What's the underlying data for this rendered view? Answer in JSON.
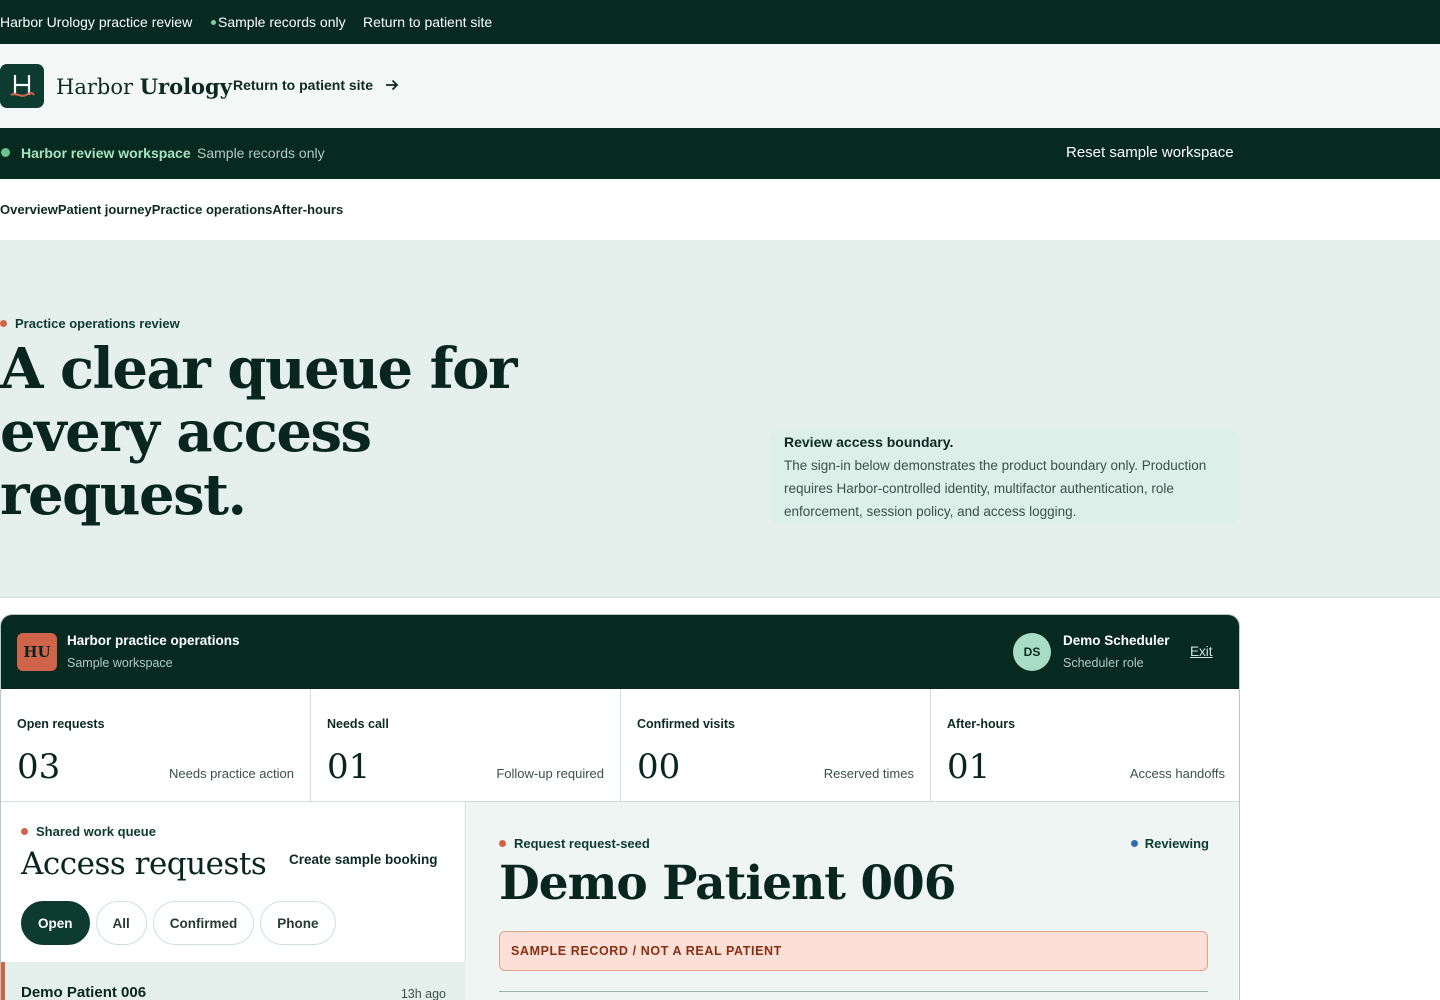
{
  "topbar": {
    "title": "Harbor Urology practice review",
    "sample_note": "Sample records only",
    "return_link": "Return to patient site"
  },
  "brand": {
    "name_light": "Harbor",
    "name_bold": "Urology",
    "return_link": "Return to patient site"
  },
  "workspace_bar": {
    "name": "Harbor review workspace",
    "sample_note": "Sample records only",
    "reset_label": "Reset sample workspace"
  },
  "nav": {
    "items": [
      "Overview",
      "Patient journey",
      "Practice operations",
      "After-hours"
    ]
  },
  "hero": {
    "eyebrow": "Practice operations review",
    "headline": "A clear queue for every access request.",
    "notice_title": "Review access boundary.",
    "notice_body": "The sign-in below demonstrates the product boundary only. Production requires Harbor-controlled identity, multifactor authentication, role enforcement, session policy, and access logging."
  },
  "dashboard": {
    "org_initials": "HU",
    "org_name": "Harbor practice operations",
    "org_sub": "Sample workspace",
    "user_initials": "DS",
    "user_name": "Demo Scheduler",
    "user_role": "Scheduler role",
    "exit_label": "Exit",
    "stats": [
      {
        "label": "Open requests",
        "value": "03",
        "note": "Needs practice action"
      },
      {
        "label": "Needs call",
        "value": "01",
        "note": "Follow-up required"
      },
      {
        "label": "Confirmed visits",
        "value": "00",
        "note": "Reserved times"
      },
      {
        "label": "After-hours",
        "value": "01",
        "note": "Access handoffs"
      }
    ],
    "queue": {
      "eyebrow": "Shared work queue",
      "title": "Access requests",
      "create_label": "Create sample booking",
      "filters": [
        "Open",
        "All",
        "Confirmed",
        "Phone"
      ],
      "active_filter": "Open",
      "rows": [
        {
          "name": "Demo Patient 006",
          "time": "13h ago"
        }
      ]
    },
    "detail": {
      "eyebrow": "Request request-seed",
      "status": "Reviewing",
      "patient_name": "Demo Patient 006",
      "warning": "SAMPLE RECORD / NOT A REAL PATIENT"
    }
  },
  "colors": {
    "dark_green": "#062a20",
    "accent_coral": "#d0644a",
    "hero_bg": "#e5f0ec",
    "status_blue": "#2f6fb0"
  }
}
